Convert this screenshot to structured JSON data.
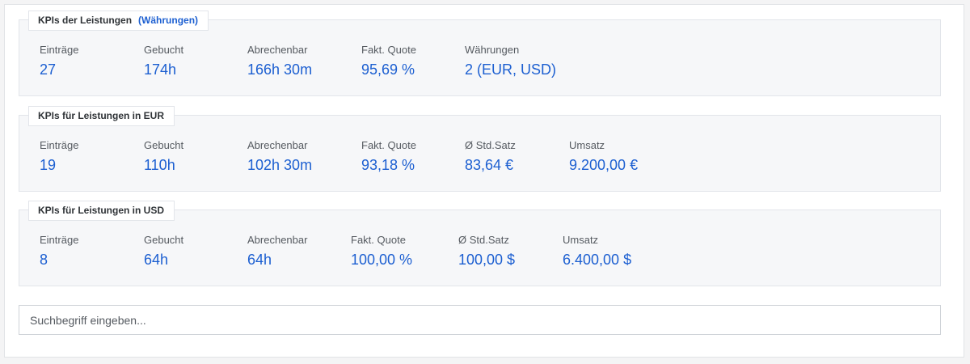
{
  "panels": [
    {
      "title": "KPIs der Leistungen",
      "link": "(Währungen)",
      "kpis": [
        {
          "label": "Einträge",
          "value": "27"
        },
        {
          "label": "Gebucht",
          "value": "174h"
        },
        {
          "label": "Abrechenbar",
          "value": "166h 30m"
        },
        {
          "label": "Fakt. Quote",
          "value": "95,69 %"
        },
        {
          "label": "Währungen",
          "value": "2 (EUR, USD)"
        }
      ]
    },
    {
      "title": "KPIs für Leistungen in EUR",
      "kpis": [
        {
          "label": "Einträge",
          "value": "19"
        },
        {
          "label": "Gebucht",
          "value": "110h"
        },
        {
          "label": "Abrechenbar",
          "value": "102h 30m"
        },
        {
          "label": "Fakt. Quote",
          "value": "93,18 %"
        },
        {
          "label": "Ø Std.Satz",
          "value": "83,64 €"
        },
        {
          "label": "Umsatz",
          "value": "9.200,00 €"
        }
      ]
    },
    {
      "title": "KPIs für Leistungen in USD",
      "kpis": [
        {
          "label": "Einträge",
          "value": "8"
        },
        {
          "label": "Gebucht",
          "value": "64h"
        },
        {
          "label": "Abrechenbar",
          "value": "64h"
        },
        {
          "label": "Fakt. Quote",
          "value": "100,00 %"
        },
        {
          "label": "Ø Std.Satz",
          "value": "100,00 $"
        },
        {
          "label": "Umsatz",
          "value": "6.400,00 $"
        }
      ]
    }
  ],
  "search": {
    "placeholder": "Suchbegriff eingeben..."
  },
  "colors": {
    "accent": "#1c5fd1",
    "panel_bg": "#f6f7f9",
    "label": "#555a60"
  }
}
